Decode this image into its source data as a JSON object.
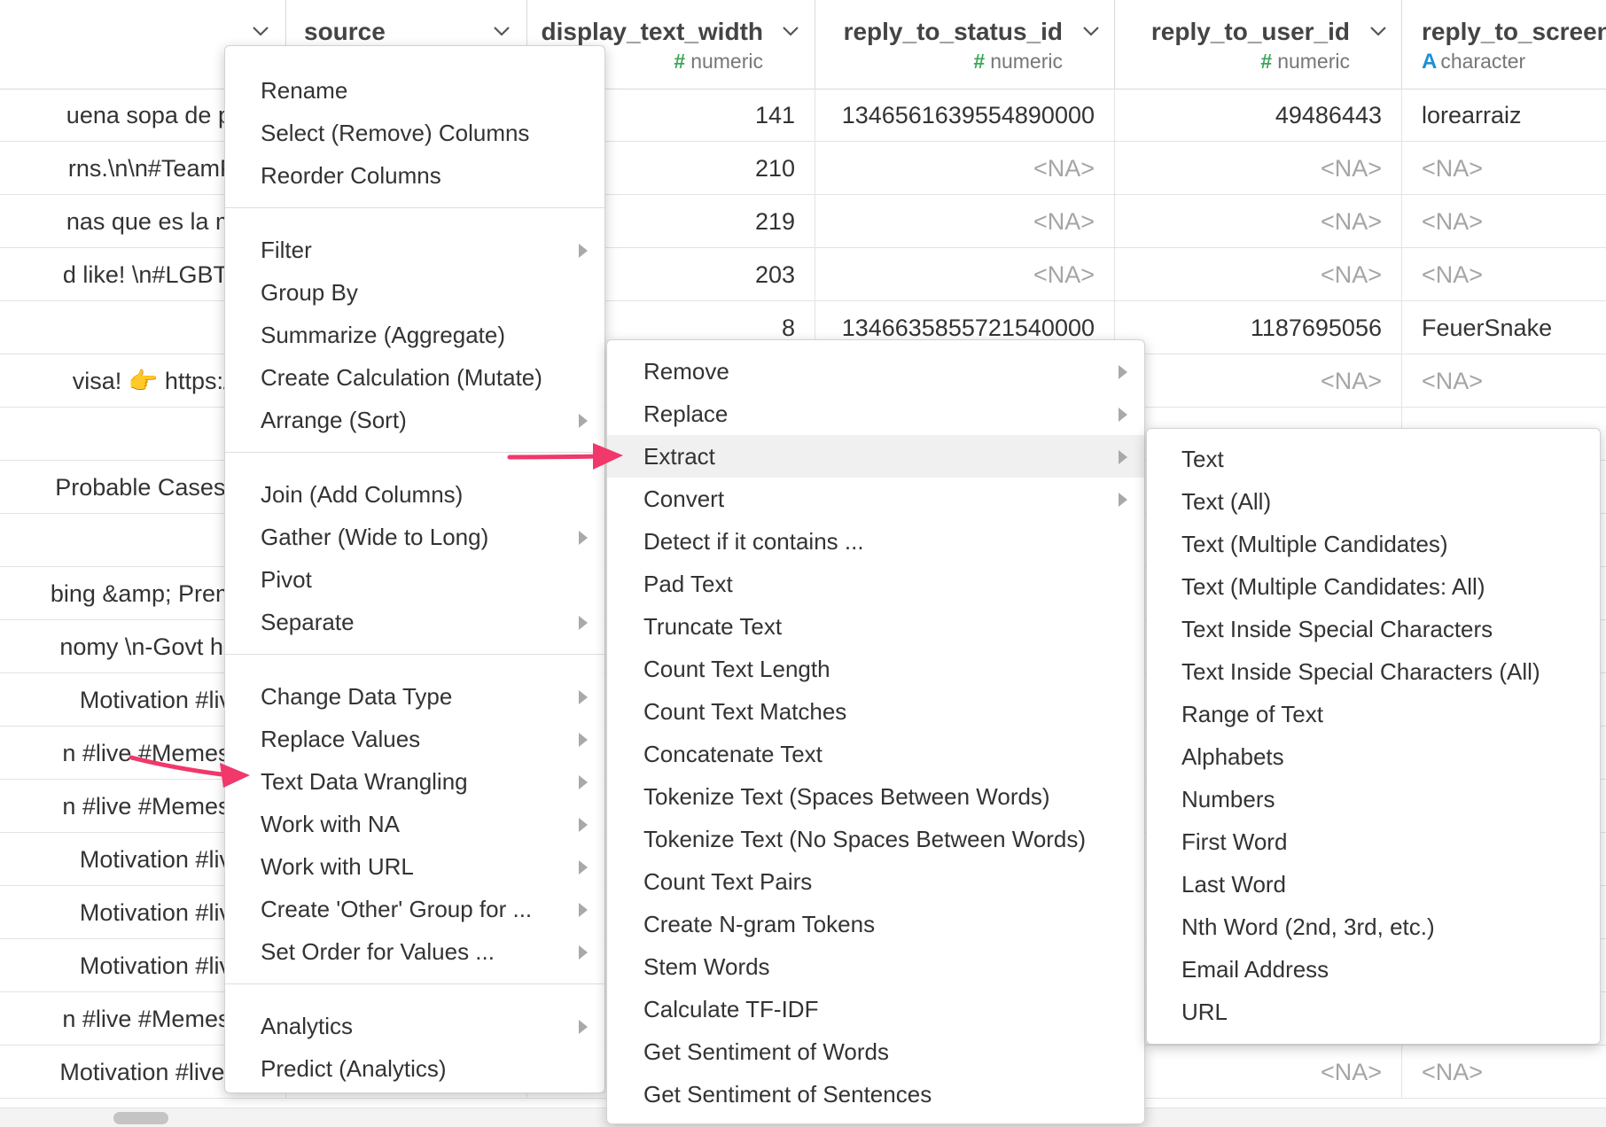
{
  "grid": {
    "columns": [
      {
        "name": "",
        "type": ""
      },
      {
        "name": "source",
        "type": ""
      },
      {
        "name": "display_text_width",
        "type": "numeric"
      },
      {
        "name": "reply_to_status_id",
        "type": "numeric"
      },
      {
        "name": "reply_to_user_id",
        "type": "numeric"
      },
      {
        "name": "reply_to_screen",
        "type": "character"
      }
    ],
    "type_icons": {
      "numeric": "#",
      "character": "A"
    },
    "rows": [
      {
        "text": "uena sopa de pollo!!",
        "width": "141",
        "status_id": "1346561639554890000",
        "user_id": "49486443",
        "screen": "lorearraiz"
      },
      {
        "text": "rns.\\n\\n#TeamPNP \\",
        "width": "210",
        "status_id": "<NA>",
        "user_id": "<NA>",
        "screen": "<NA>"
      },
      {
        "text": "nas que es la mayor",
        "width": "219",
        "status_id": "<NA>",
        "user_id": "<NA>",
        "screen": "<NA>"
      },
      {
        "text": "d like! \\n#LGBT #CC",
        "width": "203",
        "status_id": "<NA>",
        "user_id": "<NA>",
        "screen": "<NA>"
      },
      {
        "text": "",
        "width": "8",
        "status_id": "1346635855721540000",
        "user_id": "1187695056",
        "screen": "FeuerSnake"
      },
      {
        "text": "visa! 👉 https://t.co/",
        "width": "",
        "status_id": "",
        "user_id": "<NA>",
        "screen": "<NA>"
      },
      {
        "text": "",
        "width": "",
        "status_id": "",
        "user_id": "",
        "screen": ""
      },
      {
        "text": "Probable Cases🛑 \\n",
        "width": "",
        "status_id": "",
        "user_id": "",
        "screen": ""
      },
      {
        "text": "",
        "width": "",
        "status_id": "",
        "user_id": "",
        "screen": ""
      },
      {
        "text": "bing &amp; Premier L",
        "width": "",
        "status_id": "",
        "user_id": "",
        "screen": ""
      },
      {
        "text": "nomy \\n-Govt has no",
        "width": "",
        "status_id": "",
        "user_id": "",
        "screen": ""
      },
      {
        "text": "Motivation  #liveline",
        "width": "",
        "status_id": "",
        "user_id": "",
        "screen": ""
      },
      {
        "text": "n #live #Memes #gift",
        "width": "",
        "status_id": "",
        "user_id": "",
        "screen": ""
      },
      {
        "text": "n #live #Memes #gift",
        "width": "",
        "status_id": "",
        "user_id": "",
        "screen": ""
      },
      {
        "text": "Motivation  #liveline",
        "width": "",
        "status_id": "",
        "user_id": "",
        "screen": ""
      },
      {
        "text": "Motivation  #liveline",
        "width": "",
        "status_id": "",
        "user_id": "",
        "screen": ""
      },
      {
        "text": "Motivation  #liveline",
        "width": "",
        "status_id": "",
        "user_id": "",
        "screen": ""
      },
      {
        "text": "n #live #Memes #gift",
        "width": "",
        "status_id": "",
        "user_id": "",
        "screen": ""
      },
      {
        "text": "Motivation  #liveline  #",
        "width": "",
        "status_id": "",
        "user_id": "<NA>",
        "screen": "<NA>"
      }
    ]
  },
  "menus": {
    "column_menu": {
      "groups": [
        [
          {
            "label": "Rename",
            "submenu": false
          },
          {
            "label": "Select (Remove) Columns",
            "submenu": false
          },
          {
            "label": "Reorder Columns",
            "submenu": false
          }
        ],
        [
          {
            "label": "Filter",
            "submenu": true
          },
          {
            "label": "Group By",
            "submenu": false
          },
          {
            "label": "Summarize (Aggregate)",
            "submenu": false
          },
          {
            "label": "Create Calculation (Mutate)",
            "submenu": false
          },
          {
            "label": "Arrange (Sort)",
            "submenu": true
          }
        ],
        [
          {
            "label": "Join (Add Columns)",
            "submenu": false
          },
          {
            "label": "Gather (Wide to Long)",
            "submenu": true
          },
          {
            "label": "Pivot",
            "submenu": false
          },
          {
            "label": "Separate",
            "submenu": true
          }
        ],
        [
          {
            "label": "Change Data Type",
            "submenu": true
          },
          {
            "label": "Replace Values",
            "submenu": true
          },
          {
            "label": "Text Data Wrangling",
            "submenu": true
          },
          {
            "label": "Work with NA",
            "submenu": true
          },
          {
            "label": "Work with URL",
            "submenu": true
          },
          {
            "label": "Create 'Other' Group for ...",
            "submenu": true
          },
          {
            "label": "Set Order for Values ...",
            "submenu": true
          }
        ],
        [
          {
            "label": "Analytics",
            "submenu": true
          },
          {
            "label": "Predict (Analytics)",
            "submenu": false
          }
        ]
      ]
    },
    "text_menu": {
      "items": [
        {
          "label": "Remove",
          "submenu": true
        },
        {
          "label": "Replace",
          "submenu": true
        },
        {
          "label": "Extract",
          "submenu": true,
          "highlighted": true
        },
        {
          "label": "Convert",
          "submenu": true
        },
        {
          "label": "Detect if it contains ...",
          "submenu": false
        },
        {
          "label": "Pad Text",
          "submenu": false
        },
        {
          "label": "Truncate Text",
          "submenu": false
        },
        {
          "label": "Count Text Length",
          "submenu": false
        },
        {
          "label": "Count Text Matches",
          "submenu": false
        },
        {
          "label": "Concatenate Text",
          "submenu": false
        },
        {
          "label": "Tokenize Text (Spaces Between Words)",
          "submenu": false
        },
        {
          "label": "Tokenize Text (No Spaces Between Words)",
          "submenu": false
        },
        {
          "label": "Count Text Pairs",
          "submenu": false
        },
        {
          "label": "Create N-gram Tokens",
          "submenu": false
        },
        {
          "label": "Stem Words",
          "submenu": false
        },
        {
          "label": "Calculate TF-IDF",
          "submenu": false
        },
        {
          "label": "Get Sentiment of Words",
          "submenu": false
        },
        {
          "label": "Get Sentiment of Sentences",
          "submenu": false
        }
      ]
    },
    "extract_menu": {
      "items": [
        "Text",
        "Text (All)",
        "Text (Multiple Candidates)",
        "Text (Multiple Candidates: All)",
        "Text Inside Special Characters",
        "Text Inside Special Characters (All)",
        "Range of Text",
        "Alphabets",
        "Numbers",
        "First Word",
        "Last Word",
        "Nth Word (2nd, 3rd, etc.)",
        "Email Address",
        "URL"
      ]
    }
  },
  "colors": {
    "arrow": "#f0386b",
    "numeric_icon": "#3aa757",
    "character_icon": "#1f8fd4",
    "na_text": "#a5a5a5"
  }
}
